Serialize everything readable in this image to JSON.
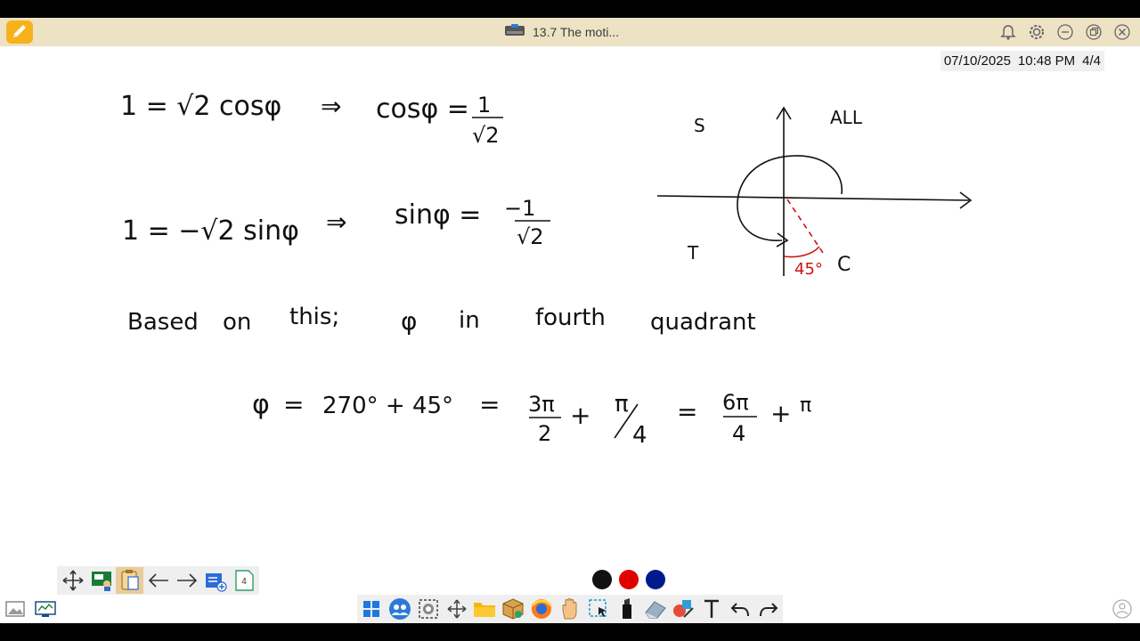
{
  "titlebar": {
    "title": "13.7 The moti..."
  },
  "status": {
    "date": "07/10/2025",
    "time": "10:48 PM",
    "page": "4/4"
  },
  "notes": {
    "eq1_left": "1 = √2 cosφ",
    "eq1_arrow": "⇒",
    "eq1_right": "cosφ =",
    "eq1_num": "1",
    "eq1_den": "√2",
    "eq2_left": "1 = −√2 sinφ",
    "eq2_arrow": "⇒",
    "eq2_right": "sinφ =",
    "eq2_num": "−1",
    "eq2_den": "√2",
    "sentence": [
      "Based",
      "on",
      "this;",
      "φ",
      "in",
      "fourth",
      "quadrant"
    ],
    "eq3_lhs": "φ",
    "eq3_eq": "=",
    "eq3_terms": "270° + 45°",
    "eq3_eq2": "=",
    "eq3_f1_num": "3π",
    "eq3_f1_den": "2",
    "eq3_plus": "+",
    "eq3_f2_num": "π",
    "eq3_f2_den": "4",
    "eq3_eq3": "=",
    "eq3_f3_num": "6π",
    "eq3_f3_den": "4",
    "eq3_plus2": "+",
    "eq3_partial": "π"
  },
  "quadrants": {
    "q2": "S",
    "q1": "ALL",
    "q3": "T",
    "q4": "C",
    "angle": "45°"
  },
  "toolbar": {
    "page_count": "4"
  },
  "palette": {
    "colors": [
      "#111111",
      "#e00000",
      "#001a8c"
    ]
  },
  "colors": {
    "titlebar_bg": "#ede2c4",
    "accent_red": "#cc1111"
  }
}
